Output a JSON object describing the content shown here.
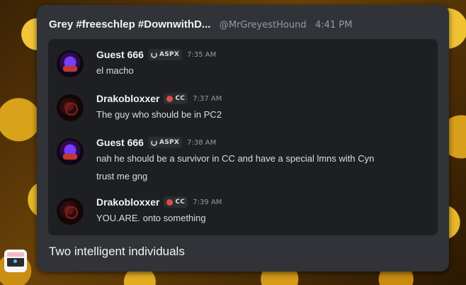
{
  "header": {
    "display_name": "Grey #freeschlep #DownwithD...",
    "handle": "@MrGreyestHound",
    "time": "4:41 PM"
  },
  "messages": [
    {
      "author": "Guest 666",
      "tag": "ASPX",
      "tag_icon": "aspx-icon",
      "time": "7:35 AM",
      "lines": [
        "el macho"
      ]
    },
    {
      "author": "Drakobloxxer",
      "tag": "CC",
      "tag_icon": "cc-icon",
      "time": "7:37 AM",
      "lines": [
        "The guy who should be in PC2"
      ]
    },
    {
      "author": "Guest 666",
      "tag": "ASPX",
      "tag_icon": "aspx-icon",
      "time": "7:38 AM",
      "lines": [
        "nah he should be a survivor in CC and have a special lmns with Cyn",
        "trust me gng"
      ]
    },
    {
      "author": "Drakobloxxer",
      "tag": "CC",
      "tag_icon": "cc-icon",
      "time": "7:39 AM",
      "lines": [
        "YOU.ARE. onto something"
      ]
    }
  ],
  "caption": "Two intelligent individuals",
  "colors": {
    "card_bg": "#313338",
    "inner_bg": "#1e1f22",
    "muted": "#949ba4",
    "cc_red": "#e24b4b"
  }
}
